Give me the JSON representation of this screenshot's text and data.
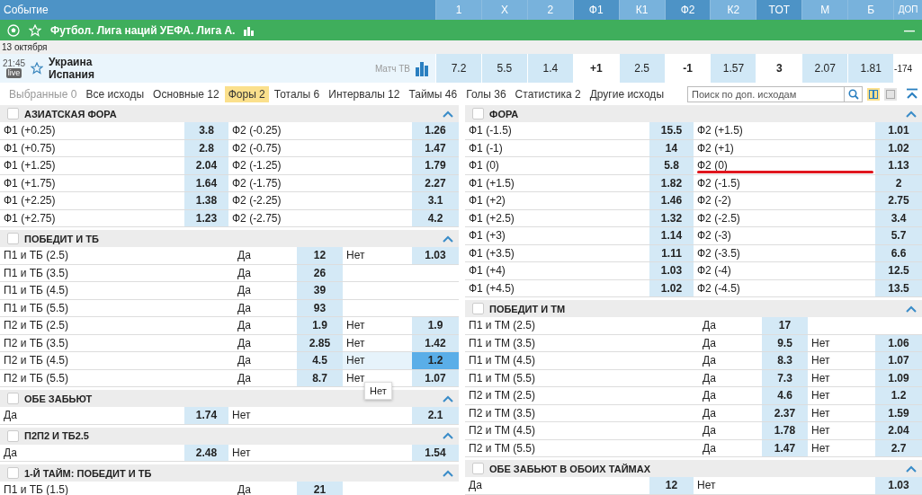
{
  "header": {
    "event_label": "Событие",
    "columns": [
      {
        "label": "1",
        "kind": "odds"
      },
      {
        "label": "X",
        "kind": "odds"
      },
      {
        "label": "2",
        "kind": "odds"
      },
      {
        "label": "Ф1",
        "kind": "param"
      },
      {
        "label": "К1",
        "kind": "odds"
      },
      {
        "label": "Ф2",
        "kind": "param"
      },
      {
        "label": "К2",
        "kind": "odds"
      },
      {
        "label": "ТОТ",
        "kind": "param"
      },
      {
        "label": "М",
        "kind": "odds"
      },
      {
        "label": "Б",
        "kind": "odds"
      },
      {
        "label": "ДОП",
        "kind": "extra"
      }
    ]
  },
  "league": {
    "title": "Футбол. Лига наций УЕФА. Лига А.",
    "collapse": "—"
  },
  "date": "13 октября",
  "event": {
    "time": "21:45",
    "live_badge": "live",
    "teams": [
      "Украина",
      "Испания"
    ],
    "channel": "Матч ТВ",
    "cells": [
      {
        "text": "7.2",
        "kind": "odds"
      },
      {
        "text": "5.5",
        "kind": "odds"
      },
      {
        "text": "1.4",
        "kind": "odds"
      },
      {
        "text": "+1",
        "kind": "param"
      },
      {
        "text": "2.5",
        "kind": "odds"
      },
      {
        "text": "-1",
        "kind": "param"
      },
      {
        "text": "1.57",
        "kind": "odds"
      },
      {
        "text": "3",
        "kind": "param"
      },
      {
        "text": "2.07",
        "kind": "odds"
      },
      {
        "text": "1.81",
        "kind": "odds"
      },
      {
        "text": "-174",
        "kind": "extra"
      }
    ]
  },
  "tabs": [
    {
      "label": "Выбранные 0",
      "selected": false,
      "disabled": true
    },
    {
      "label": "Все исходы",
      "selected": false,
      "disabled": false
    },
    {
      "label": "Основные 12",
      "selected": false,
      "disabled": false
    },
    {
      "label": "Форы 2",
      "selected": true,
      "disabled": false
    },
    {
      "label": "Тоталы 6",
      "selected": false,
      "disabled": false
    },
    {
      "label": "Интервалы 12",
      "selected": false,
      "disabled": false
    },
    {
      "label": "Таймы 46",
      "selected": false,
      "disabled": false
    },
    {
      "label": "Голы 36",
      "selected": false,
      "disabled": false
    },
    {
      "label": "Статистика 2",
      "selected": false,
      "disabled": false
    },
    {
      "label": "Другие исходы",
      "selected": false,
      "disabled": false
    }
  ],
  "search": {
    "placeholder": "Поиск по доп. исходам"
  },
  "view_modes": [
    {
      "kind": "two-columns",
      "selected": true
    },
    {
      "kind": "one-column",
      "selected": false
    }
  ],
  "columns": [
    {
      "markets": [
        {
          "title": "АЗИАТСКАЯ ФОРА",
          "checked": false,
          "expanded": true,
          "rows": [
            {
              "kind": "pair",
              "outcomes": [
                {
                  "label": "Ф1 (+0.25)",
                  "odd": "3.8",
                  "selected": false
                },
                {
                  "label": "Ф2 (-0.25)",
                  "odd": "1.26",
                  "selected": false
                }
              ]
            },
            {
              "kind": "pair",
              "outcomes": [
                {
                  "label": "Ф1 (+0.75)",
                  "odd": "2.8",
                  "selected": false
                },
                {
                  "label": "Ф2 (-0.75)",
                  "odd": "1.47",
                  "selected": false
                }
              ]
            },
            {
              "kind": "pair",
              "outcomes": [
                {
                  "label": "Ф1 (+1.25)",
                  "odd": "2.04",
                  "selected": false
                },
                {
                  "label": "Ф2 (-1.25)",
                  "odd": "1.79",
                  "selected": false
                }
              ]
            },
            {
              "kind": "pair",
              "outcomes": [
                {
                  "label": "Ф1 (+1.75)",
                  "odd": "1.64",
                  "selected": false
                },
                {
                  "label": "Ф2 (-1.75)",
                  "odd": "2.27",
                  "selected": false
                }
              ]
            },
            {
              "kind": "pair",
              "outcomes": [
                {
                  "label": "Ф1 (+2.25)",
                  "odd": "1.38",
                  "selected": false
                },
                {
                  "label": "Ф2 (-2.25)",
                  "odd": "3.1",
                  "selected": false
                }
              ]
            },
            {
              "kind": "pair",
              "outcomes": [
                {
                  "label": "Ф1 (+2.75)",
                  "odd": "1.23",
                  "selected": false
                },
                {
                  "label": "Ф2 (-2.75)",
                  "odd": "4.2",
                  "selected": false
                }
              ]
            }
          ]
        },
        {
          "title": "ПОБЕДИТ И ТБ",
          "checked": false,
          "expanded": true,
          "rows": [
            {
              "kind": "yesno",
              "name": "П1 и ТБ (2.5)",
              "outcomes": [
                {
                  "label": "Да",
                  "odd": "12",
                  "selected": false
                },
                {
                  "label": "Нет",
                  "odd": "1.03",
                  "selected": false
                }
              ]
            },
            {
              "kind": "yesno",
              "name": "П1 и ТБ (3.5)",
              "outcomes": [
                {
                  "label": "Да",
                  "odd": "26",
                  "selected": false
                }
              ]
            },
            {
              "kind": "yesno",
              "name": "П1 и ТБ (4.5)",
              "outcomes": [
                {
                  "label": "Да",
                  "odd": "39",
                  "selected": false
                }
              ]
            },
            {
              "kind": "yesno",
              "name": "П1 и ТБ (5.5)",
              "outcomes": [
                {
                  "label": "Да",
                  "odd": "93",
                  "selected": false
                }
              ]
            },
            {
              "kind": "yesno",
              "name": "П2 и ТБ (2.5)",
              "outcomes": [
                {
                  "label": "Да",
                  "odd": "1.9",
                  "selected": false
                },
                {
                  "label": "Нет",
                  "odd": "1.9",
                  "selected": false
                }
              ]
            },
            {
              "kind": "yesno",
              "name": "П2 и ТБ (3.5)",
              "outcomes": [
                {
                  "label": "Да",
                  "odd": "2.85",
                  "selected": false
                },
                {
                  "label": "Нет",
                  "odd": "1.42",
                  "selected": false
                }
              ]
            },
            {
              "kind": "yesno",
              "name": "П2 и ТБ (4.5)",
              "outcomes": [
                {
                  "label": "Да",
                  "odd": "4.5",
                  "selected": false
                },
                {
                  "label": "Нет",
                  "odd": "1.2",
                  "selected": true
                }
              ]
            },
            {
              "kind": "yesno",
              "name": "П2 и ТБ (5.5)",
              "tooltip": "Нет",
              "outcomes": [
                {
                  "label": "Да",
                  "odd": "8.7",
                  "selected": false
                },
                {
                  "label": "Нет",
                  "odd": "1.07",
                  "selected": false
                }
              ]
            }
          ]
        },
        {
          "title": "ОБЕ ЗАБЬЮТ",
          "checked": false,
          "expanded": true,
          "rows": [
            {
              "kind": "pair",
              "outcomes": [
                {
                  "label": "Да",
                  "odd": "1.74",
                  "selected": false
                },
                {
                  "label": "Нет",
                  "odd": "2.1",
                  "selected": false
                }
              ]
            }
          ]
        },
        {
          "title": "П2П2 И ТБ2.5",
          "checked": false,
          "expanded": true,
          "rows": [
            {
              "kind": "pair",
              "outcomes": [
                {
                  "label": "Да",
                  "odd": "2.48",
                  "selected": false
                },
                {
                  "label": "Нет",
                  "odd": "1.54",
                  "selected": false
                }
              ]
            }
          ]
        },
        {
          "title": "1-Й ТАЙМ: ПОБЕДИТ И ТБ",
          "checked": false,
          "expanded": true,
          "rows": [
            {
              "kind": "yesno",
              "name": "П1 и ТБ (1.5)",
              "outcomes": [
                {
                  "label": "Да",
                  "odd": "21",
                  "selected": false
                }
              ]
            }
          ]
        }
      ]
    },
    {
      "markets": [
        {
          "title": "ФОРА",
          "checked": false,
          "expanded": true,
          "rows": [
            {
              "kind": "pair",
              "outcomes": [
                {
                  "label": "Ф1 (-1.5)",
                  "odd": "15.5",
                  "selected": false
                },
                {
                  "label": "Ф2 (+1.5)",
                  "odd": "1.01",
                  "selected": false
                }
              ]
            },
            {
              "kind": "pair",
              "outcomes": [
                {
                  "label": "Ф1 (-1)",
                  "odd": "14",
                  "selected": false
                },
                {
                  "label": "Ф2 (+1)",
                  "odd": "1.02",
                  "selected": false
                }
              ]
            },
            {
              "kind": "pair",
              "underlined": true,
              "outcomes": [
                {
                  "label": "Ф1 (0)",
                  "odd": "5.8",
                  "selected": false
                },
                {
                  "label": "Ф2 (0)",
                  "odd": "1.13",
                  "selected": false
                }
              ]
            },
            {
              "kind": "pair",
              "outcomes": [
                {
                  "label": "Ф1 (+1.5)",
                  "odd": "1.82",
                  "selected": false
                },
                {
                  "label": "Ф2 (-1.5)",
                  "odd": "2",
                  "selected": false
                }
              ]
            },
            {
              "kind": "pair",
              "outcomes": [
                {
                  "label": "Ф1 (+2)",
                  "odd": "1.46",
                  "selected": false
                },
                {
                  "label": "Ф2 (-2)",
                  "odd": "2.75",
                  "selected": false
                }
              ]
            },
            {
              "kind": "pair",
              "outcomes": [
                {
                  "label": "Ф1 (+2.5)",
                  "odd": "1.32",
                  "selected": false
                },
                {
                  "label": "Ф2 (-2.5)",
                  "odd": "3.4",
                  "selected": false
                }
              ]
            },
            {
              "kind": "pair",
              "outcomes": [
                {
                  "label": "Ф1 (+3)",
                  "odd": "1.14",
                  "selected": false
                },
                {
                  "label": "Ф2 (-3)",
                  "odd": "5.7",
                  "selected": false
                }
              ]
            },
            {
              "kind": "pair",
              "outcomes": [
                {
                  "label": "Ф1 (+3.5)",
                  "odd": "1.11",
                  "selected": false
                },
                {
                  "label": "Ф2 (-3.5)",
                  "odd": "6.6",
                  "selected": false
                }
              ]
            },
            {
              "kind": "pair",
              "outcomes": [
                {
                  "label": "Ф1 (+4)",
                  "odd": "1.03",
                  "selected": false
                },
                {
                  "label": "Ф2 (-4)",
                  "odd": "12.5",
                  "selected": false
                }
              ]
            },
            {
              "kind": "pair",
              "outcomes": [
                {
                  "label": "Ф1 (+4.5)",
                  "odd": "1.02",
                  "selected": false
                },
                {
                  "label": "Ф2 (-4.5)",
                  "odd": "13.5",
                  "selected": false
                }
              ]
            }
          ]
        },
        {
          "title": "ПОБЕДИТ И ТМ",
          "checked": false,
          "expanded": true,
          "rows": [
            {
              "kind": "yesno",
              "name": "П1 и ТМ (2.5)",
              "outcomes": [
                {
                  "label": "Да",
                  "odd": "17",
                  "selected": false
                }
              ]
            },
            {
              "kind": "yesno",
              "name": "П1 и ТМ (3.5)",
              "outcomes": [
                {
                  "label": "Да",
                  "odd": "9.5",
                  "selected": false
                },
                {
                  "label": "Нет",
                  "odd": "1.06",
                  "selected": false
                }
              ]
            },
            {
              "kind": "yesno",
              "name": "П1 и ТМ (4.5)",
              "outcomes": [
                {
                  "label": "Да",
                  "odd": "8.3",
                  "selected": false
                },
                {
                  "label": "Нет",
                  "odd": "1.07",
                  "selected": false
                }
              ]
            },
            {
              "kind": "yesno",
              "name": "П1 и ТМ (5.5)",
              "outcomes": [
                {
                  "label": "Да",
                  "odd": "7.3",
                  "selected": false
                },
                {
                  "label": "Нет",
                  "odd": "1.09",
                  "selected": false
                }
              ]
            },
            {
              "kind": "yesno",
              "name": "П2 и ТМ (2.5)",
              "outcomes": [
                {
                  "label": "Да",
                  "odd": "4.6",
                  "selected": false
                },
                {
                  "label": "Нет",
                  "odd": "1.2",
                  "selected": false
                }
              ]
            },
            {
              "kind": "yesno",
              "name": "П2 и ТМ (3.5)",
              "outcomes": [
                {
                  "label": "Да",
                  "odd": "2.37",
                  "selected": false
                },
                {
                  "label": "Нет",
                  "odd": "1.59",
                  "selected": false
                }
              ]
            },
            {
              "kind": "yesno",
              "name": "П2 и ТМ (4.5)",
              "outcomes": [
                {
                  "label": "Да",
                  "odd": "1.78",
                  "selected": false
                },
                {
                  "label": "Нет",
                  "odd": "2.04",
                  "selected": false
                }
              ]
            },
            {
              "kind": "yesno",
              "name": "П2 и ТМ (5.5)",
              "outcomes": [
                {
                  "label": "Да",
                  "odd": "1.47",
                  "selected": false
                },
                {
                  "label": "Нет",
                  "odd": "2.7",
                  "selected": false
                }
              ]
            }
          ]
        },
        {
          "title": "ОБЕ ЗАБЬЮТ В ОБОИХ ТАЙМАХ",
          "checked": false,
          "expanded": true,
          "rows": [
            {
              "kind": "pair",
              "outcomes": [
                {
                  "label": "Да",
                  "odd": "12",
                  "selected": false
                },
                {
                  "label": "Нет",
                  "odd": "1.03",
                  "selected": false
                }
              ]
            }
          ]
        }
      ]
    }
  ]
}
